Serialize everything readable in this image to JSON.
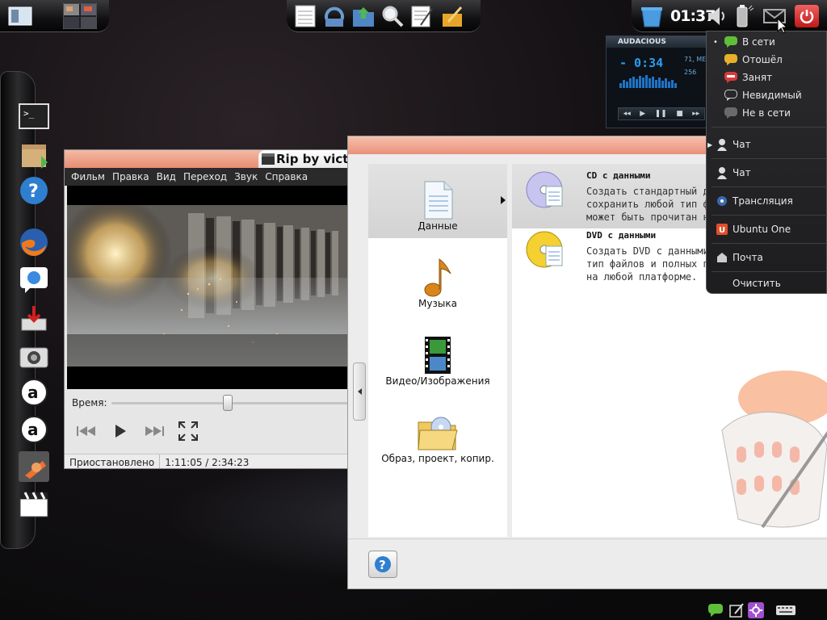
{
  "panel": {
    "clock": "01:37"
  },
  "player": {
    "title": "Rip by vict",
    "menu": [
      "Фильм",
      "Правка",
      "Вид",
      "Переход",
      "Звук",
      "Справка"
    ],
    "seek_label": "Время:",
    "progress_fraction": 0.48,
    "status": "Приостановлено",
    "time": "1:11:05 / 2:34:23"
  },
  "audacious": {
    "title": "AUDACIOUS",
    "time": "- 0:34",
    "info1": "71, ME",
    "info2": "256",
    "controls": [
      "◂◂",
      "▶",
      "❚❚",
      "■",
      "▸▸"
    ]
  },
  "brasero": {
    "categories": [
      {
        "label": "Данные",
        "icon": "document-icon",
        "selected": true
      },
      {
        "label": "Музыка",
        "icon": "music-note-icon",
        "selected": false
      },
      {
        "label": "Видео/Изображения",
        "icon": "film-strip-icon",
        "selected": false
      },
      {
        "label": "Образ, проект, копир.",
        "icon": "folder-disc-icon",
        "selected": false
      }
    ],
    "options": [
      {
        "title": "CD с данными",
        "desc": "Создать стандартный д\nсохранить любой тип ф\nможет быть прочитан н",
        "icon": "cd-icon",
        "selected": true
      },
      {
        "title": "DVD с данными",
        "desc": "Создать DVD с данными\nтип файлов и полных п\nна любой платформе.",
        "icon": "dvd-icon",
        "selected": false
      }
    ]
  },
  "im_menu": {
    "statuses": [
      {
        "label": "В сети",
        "color": "#5fbf3a",
        "active": true
      },
      {
        "label": "Отошёл",
        "color": "#e8b02a",
        "active": false
      },
      {
        "label": "Занят",
        "color": "#d83a3a",
        "active": false
      },
      {
        "label": "Невидимый",
        "color": "#c8c8c8",
        "active": false
      },
      {
        "label": "Не в сети",
        "color": "#6a6a6a",
        "active": false
      }
    ],
    "apps": [
      {
        "label": "Чат",
        "icon": "person-icon",
        "submenu": true
      },
      {
        "label": "Чат",
        "icon": "person-icon",
        "submenu": false
      },
      {
        "label": "Трансляция",
        "icon": "broadcast-icon",
        "submenu": false
      },
      {
        "label": "Ubuntu One",
        "icon": "ubuntu-one-icon",
        "submenu": false
      },
      {
        "label": "Почта",
        "icon": "mail-icon",
        "submenu": false
      }
    ],
    "clear": "Очистить"
  },
  "colors": {
    "title_bar": "#e9917a",
    "menu_bg": "#2a2a2a",
    "selection": "#d8d8d8"
  }
}
